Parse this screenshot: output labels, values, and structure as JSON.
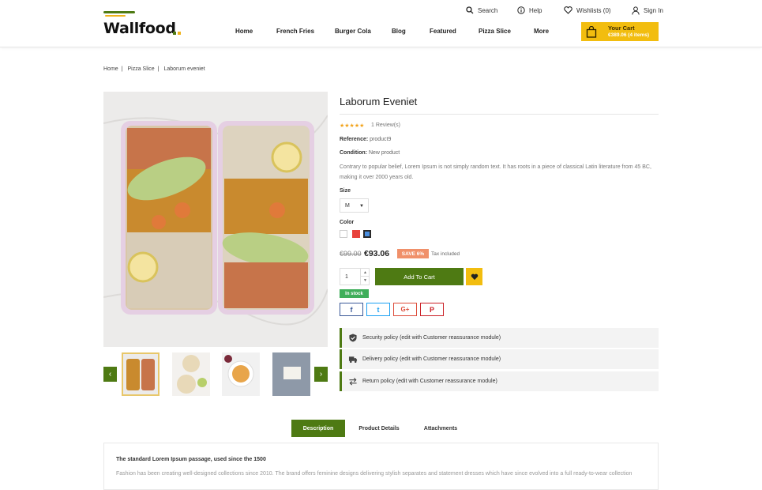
{
  "brand": {
    "name": "Wallfood"
  },
  "topnav": {
    "search": "Search",
    "help": "Help",
    "wishlists": "Wishlists (0)",
    "signin": "Sign In"
  },
  "mainnav": [
    "Home",
    "French Fries",
    "Burger Cola",
    "Blog",
    "Featured",
    "Pizza Slice",
    "More"
  ],
  "cart": {
    "title": "Your Cart",
    "summary": "€389.06 (4 items)"
  },
  "breadcrumb": [
    "Home",
    "Pizza Slice",
    "Laborum eveniet"
  ],
  "product": {
    "title": "Laborum Eveniet",
    "rating_stars": "★★★★★",
    "reviews": "1 Review(s)",
    "reference_label": "Reference:",
    "reference": "product9",
    "condition_label": "Condition:",
    "condition": "New product",
    "description": "Contrary to popular belief, Lorem Ipsum is not simply random text. It has roots in a piece of classical Latin literature from 45 BC, making it over 2000 years old.",
    "size_label": "Size",
    "size_value": "M",
    "color_label": "Color",
    "colors": [
      "#ffffff",
      "#e8413b",
      "#4a8fe0"
    ],
    "old_price": "€99.00",
    "price": "€93.06",
    "save": "SAVE 6%",
    "tax": "Tax included",
    "qty": "1",
    "add_to_cart": "Add To Cart",
    "stock": "In stock",
    "share": [
      "f",
      "t",
      "G+",
      "P"
    ]
  },
  "reassurance": [
    "Security policy (edit with Customer reassurance module)",
    "Delivery policy (edit with Customer reassurance module)",
    "Return policy (edit with Customer reassurance module)"
  ],
  "tabs": [
    "Description",
    "Product Details",
    "Attachments"
  ],
  "desc_section": {
    "heading": "The standard Lorem Ipsum passage, used since the 1500",
    "paragraph": "Fashion has been creating well-designed collections since 2010. The brand offers feminine designs delivering stylish separates and statement dresses which have since evolved into a full ready-to-wear collection"
  },
  "colors": {
    "accent": "#4e7a13",
    "yellow": "#f2bd0f",
    "save": "#f0906a",
    "stock": "#3fae5a"
  }
}
